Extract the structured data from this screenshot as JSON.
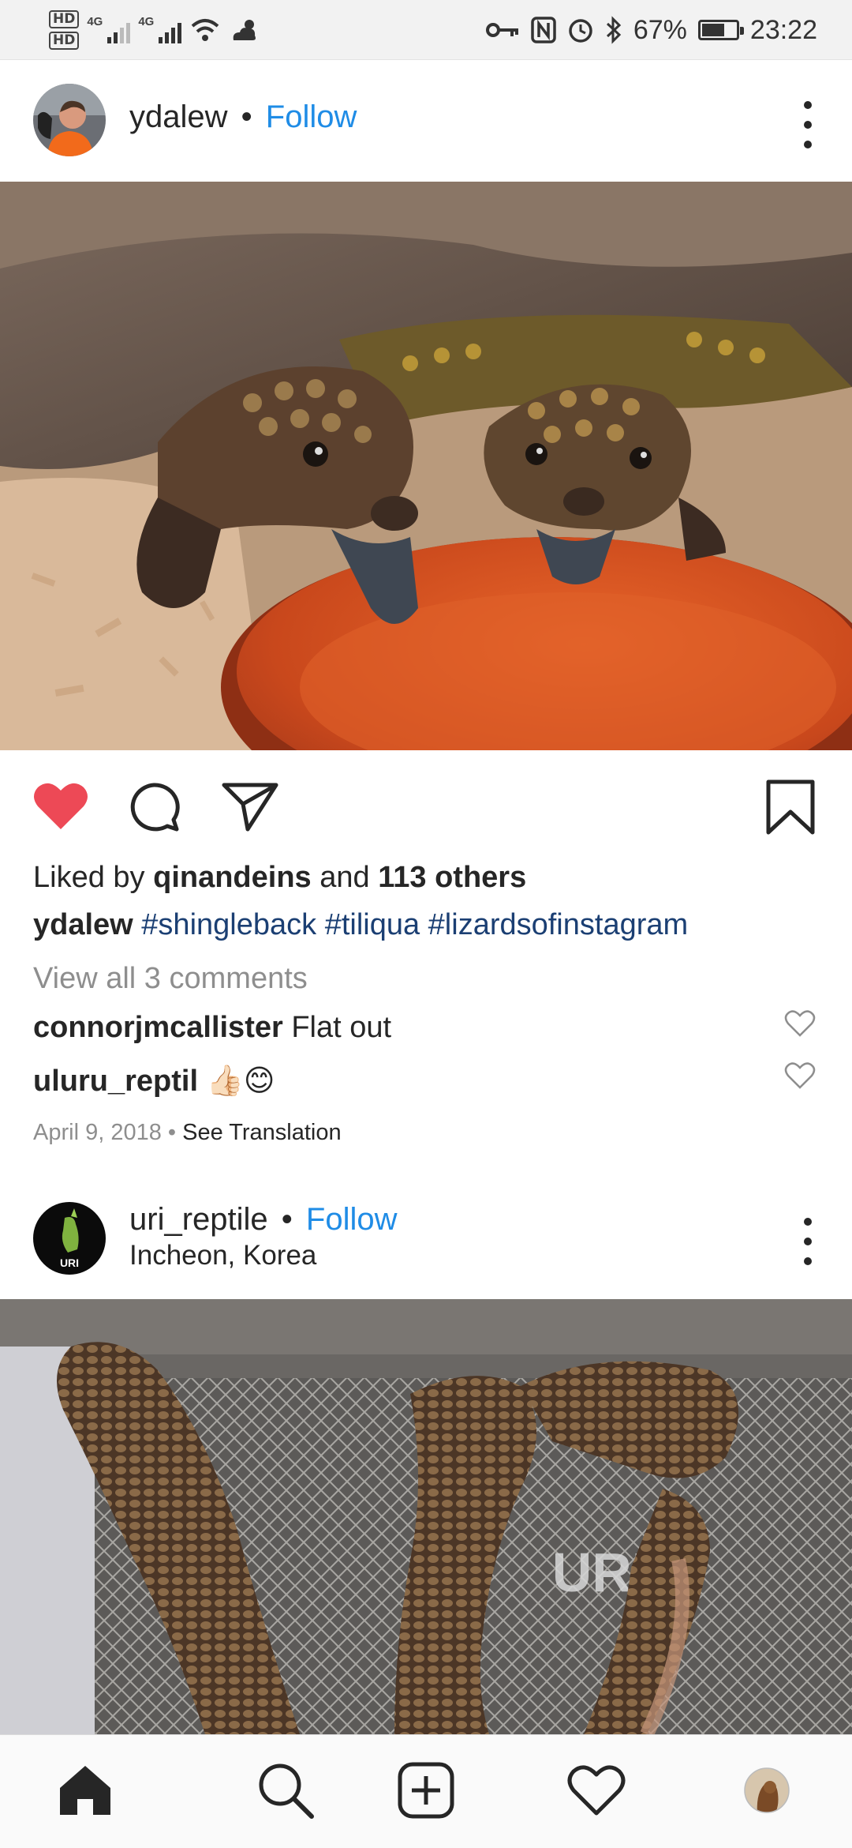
{
  "status_bar": {
    "hd_top": "HD",
    "hd_bottom": "HD",
    "net1": "4G",
    "net2": "4G",
    "battery": "67%",
    "time": "23:22"
  },
  "post1": {
    "username": "ydalew",
    "separator": "•",
    "follow_label": "Follow",
    "liked_prefix": "Liked by",
    "liked_user": "qinandeins",
    "liked_and": "and",
    "liked_others": "113 others",
    "caption_user": "ydalew",
    "hashtags": [
      "#shingleback",
      "#tiliqua",
      "#lizardsofinstagram"
    ],
    "view_comments": "View all 3 comments",
    "comments": [
      {
        "user": "connorjmcallister",
        "text": "Flat out"
      },
      {
        "user": "uluru_reptil",
        "text": "👍🏻😊"
      }
    ],
    "date": "April 9, 2018",
    "date_sep": "•",
    "see_translation": "See Translation",
    "liked": true
  },
  "post2": {
    "username": "uri_reptile",
    "separator": "•",
    "follow_label": "Follow",
    "location": "Incheon, Korea",
    "avatar_text": "URI",
    "watermark": "URI"
  },
  "colors": {
    "follow": "#1f8ce6",
    "like_red": "#ed4956",
    "hashtag": "#1b3f73"
  },
  "icons": {
    "like": "heart-icon",
    "comment": "comment-icon",
    "share": "send-icon",
    "save": "bookmark-icon",
    "nav": [
      "home-icon",
      "search-icon",
      "add-post-icon",
      "activity-heart-icon",
      "profile-avatar-icon"
    ]
  }
}
